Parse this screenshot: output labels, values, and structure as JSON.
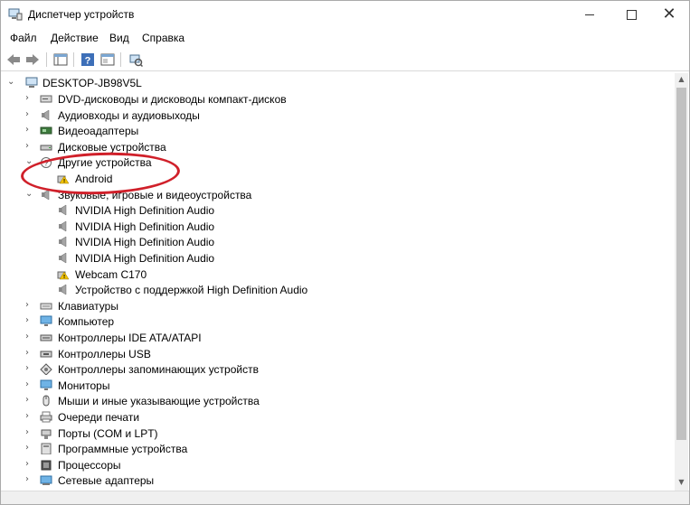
{
  "window": {
    "title": "Диспетчер устройств",
    "close_glyph": "✕"
  },
  "menu": [
    {
      "label": "Файл"
    },
    {
      "label": "Действие"
    },
    {
      "label": "Вид"
    },
    {
      "label": "Справка"
    }
  ],
  "toolbar": {
    "buttons": [
      "back-icon",
      "forward-icon",
      "show-hide-tree-icon",
      "help-icon",
      "properties-icon",
      "scan-hardware-icon"
    ]
  },
  "tree": {
    "root": "DESKTOP-JB98V5L",
    "items": [
      {
        "label": "DVD-дисководы и дисководы компакт-дисков",
        "icon": "dvd-drive-icon",
        "expanded": false
      },
      {
        "label": "Аудиовходы и аудиовыходы",
        "icon": "speaker-icon",
        "expanded": false
      },
      {
        "label": "Видеоадаптеры",
        "icon": "display-adapter-icon",
        "expanded": false
      },
      {
        "label": "Дисковые устройства",
        "icon": "disk-drive-icon",
        "expanded": false
      },
      {
        "label": "Другие устройства",
        "icon": "unknown-device-icon",
        "expanded": true
      },
      {
        "label": "Android",
        "icon": "warning-device-icon",
        "child": true
      },
      {
        "label": "Звуковые, игровые и видеоустройства",
        "icon": "speaker-icon",
        "expanded": true
      },
      {
        "label": "NVIDIA High Definition Audio",
        "icon": "speaker-icon",
        "child": true
      },
      {
        "label": "NVIDIA High Definition Audio",
        "icon": "speaker-icon",
        "child": true
      },
      {
        "label": "NVIDIA High Definition Audio",
        "icon": "speaker-icon",
        "child": true
      },
      {
        "label": "NVIDIA High Definition Audio",
        "icon": "speaker-icon",
        "child": true
      },
      {
        "label": "Webcam C170",
        "icon": "warning-device-icon",
        "child": true
      },
      {
        "label": "Устройство с поддержкой High Definition Audio",
        "icon": "speaker-icon",
        "child": true
      },
      {
        "label": "Клавиатуры",
        "icon": "keyboard-icon",
        "expanded": false
      },
      {
        "label": "Компьютер",
        "icon": "monitor-icon",
        "expanded": false
      },
      {
        "label": "Контроллеры IDE ATA/ATAPI",
        "icon": "ide-controller-icon",
        "expanded": false
      },
      {
        "label": "Контроллеры USB",
        "icon": "usb-icon",
        "expanded": false
      },
      {
        "label": "Контроллеры запоминающих устройств",
        "icon": "storage-controller-icon",
        "expanded": false
      },
      {
        "label": "Мониторы",
        "icon": "monitor-icon",
        "expanded": false
      },
      {
        "label": "Мыши и иные указывающие устройства",
        "icon": "mouse-icon",
        "expanded": false
      },
      {
        "label": "Очереди печати",
        "icon": "printer-icon",
        "expanded": false
      },
      {
        "label": "Порты (COM и LPT)",
        "icon": "port-icon",
        "expanded": false
      },
      {
        "label": "Программные устройства",
        "icon": "software-device-icon",
        "expanded": false
      },
      {
        "label": "Процессоры",
        "icon": "cpu-icon",
        "expanded": false
      },
      {
        "label": "Сетевые адаптеры",
        "icon": "network-adapter-icon",
        "expanded": false
      }
    ]
  },
  "colors": {
    "annotation": "#d0202a",
    "warning": "#f2c200"
  }
}
